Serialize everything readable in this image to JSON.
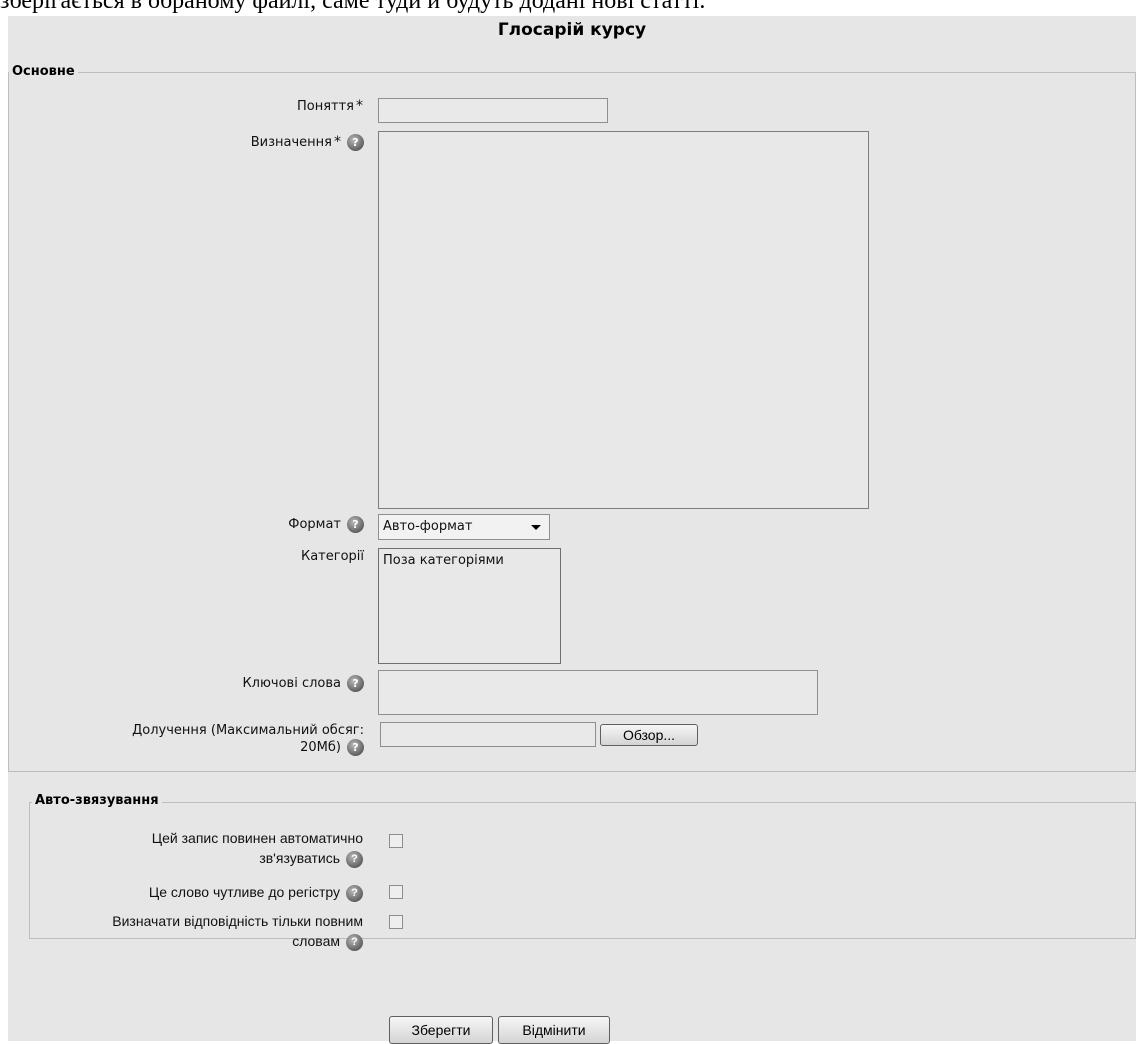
{
  "document_text": "зберігається в обраному файлі, саме туди й будуть додані нові статті.",
  "form": {
    "title": "Глосарій курсу",
    "section_main": {
      "legend": "Основне",
      "concept_label": "Поняття",
      "concept_value": "",
      "definition_label": "Визначення",
      "definition_value": "",
      "format_label": "Формат",
      "format_selected": "Авто-формат",
      "categories_label": "Категорії",
      "categories_options": [
        "Поза категоріями"
      ],
      "keywords_label": "Ключові слова",
      "keywords_value": "",
      "attachment_label_line1": "Долучення (Максимальний обсяг:",
      "attachment_label_line2": "20Мб)",
      "attachment_value": "",
      "browse_button": "Обзор..."
    },
    "section_autolink": {
      "legend": "Авто-звязування",
      "autolink_label_line1": "Цей запис повинен автоматично",
      "autolink_label_line2": "зв'язуватись",
      "autolink_checked": false,
      "case_label": "Це слово чутливе до регістру",
      "case_checked": false,
      "fullmatch_label_line1": "Визначати відповідність тільки повним",
      "fullmatch_label_line2": "словам",
      "fullmatch_checked": false
    },
    "required_marker": "*",
    "help_icon": "help-icon",
    "save_button": "Зберегти",
    "cancel_button": "Відмінити"
  },
  "colors": {
    "panel_bg": "#e6e6e6",
    "field_bg": "#e9e9e9",
    "border": "#8f8f8f"
  }
}
